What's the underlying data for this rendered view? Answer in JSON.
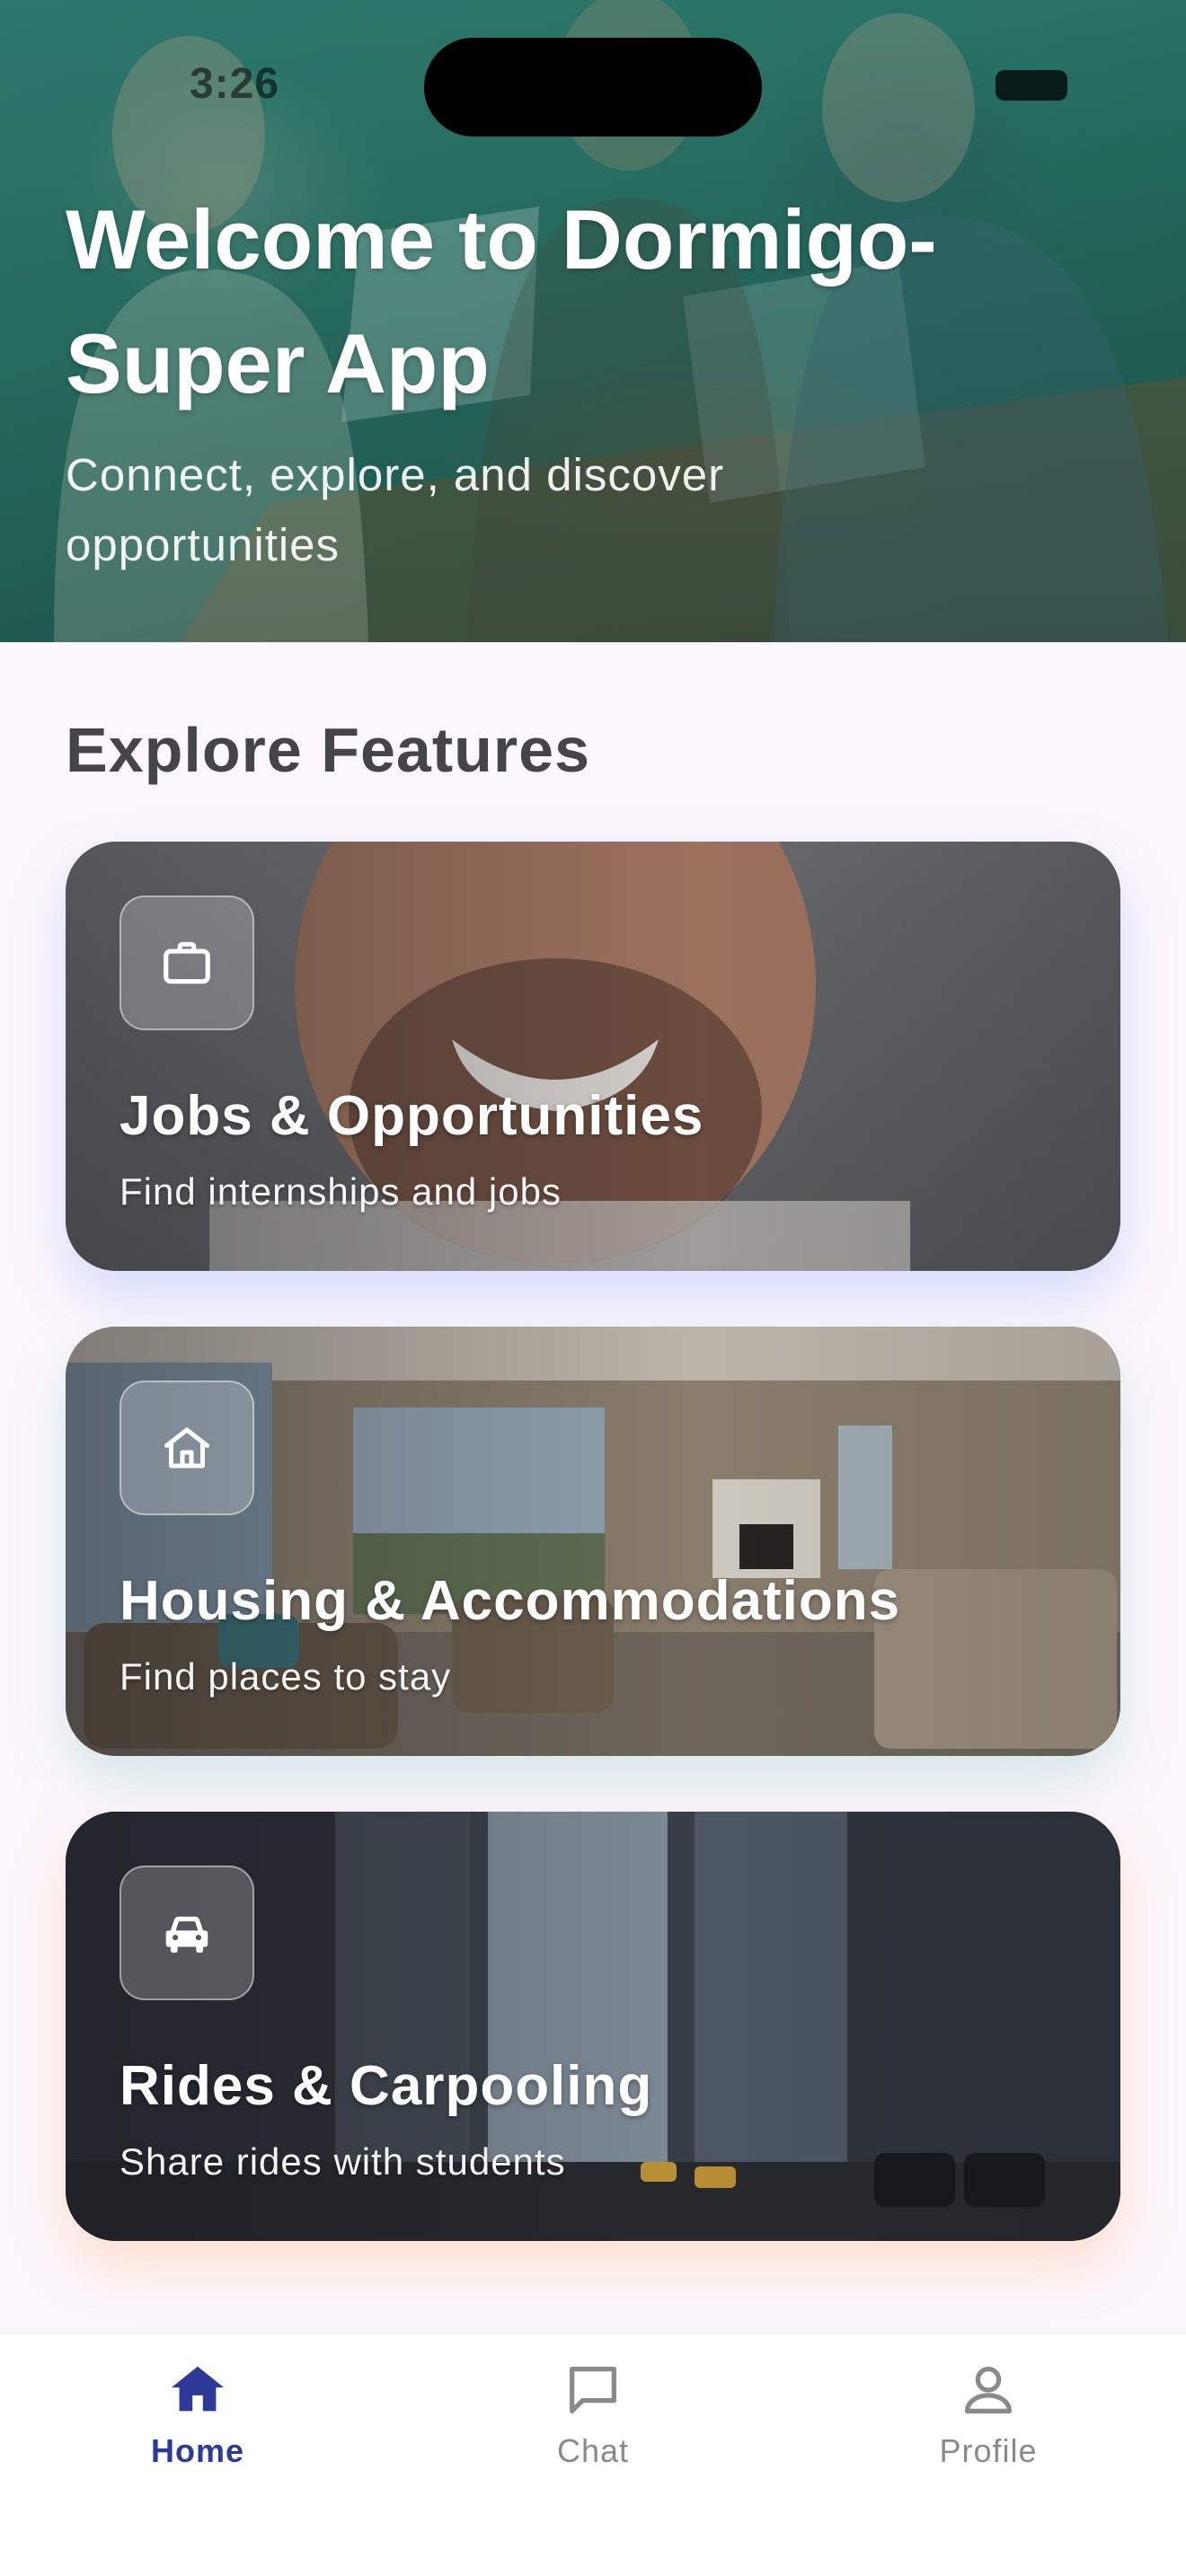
{
  "status_bar": {
    "time": "3:26"
  },
  "hero": {
    "title": "Welcome to Dormigo-Super App",
    "subtitle": "Connect, explore, and discover opportunities"
  },
  "section": {
    "title": "Explore Features"
  },
  "cards": [
    {
      "title": "Jobs & Opportunities",
      "subtitle": "Find internships and jobs",
      "icon": "briefcase-icon"
    },
    {
      "title": "Housing & Accommodations",
      "subtitle": "Find places to stay",
      "icon": "home-icon"
    },
    {
      "title": "Rides & Carpooling",
      "subtitle": "Share rides with students",
      "icon": "car-icon"
    }
  ],
  "bottom_nav": {
    "active": "Home",
    "items": [
      {
        "label": "Home",
        "icon": "home-icon"
      },
      {
        "label": "Chat",
        "icon": "chat-icon"
      },
      {
        "label": "Profile",
        "icon": "person-icon"
      }
    ]
  },
  "colors": {
    "accent": "#2d3a9a",
    "hero_tint": "#2a6b60",
    "page_bg": "#fcf7fc",
    "inactive_nav": "#8a8a8e"
  }
}
